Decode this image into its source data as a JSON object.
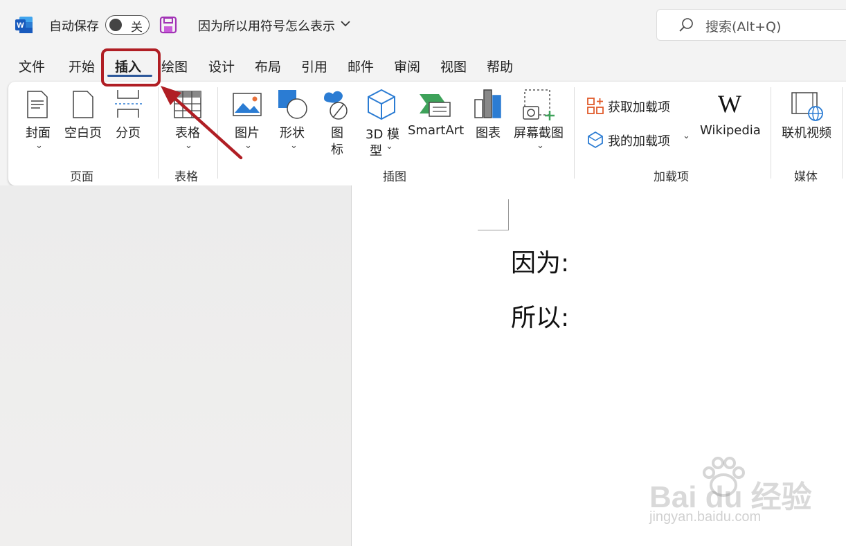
{
  "titlebar": {
    "app_icon": "word-icon",
    "autosave_label": "自动保存",
    "autosave_state": "关",
    "save_icon": "save-icon",
    "doc_title": "因为所以用符号怎么表示",
    "search_placeholder": "搜索(Alt+Q)"
  },
  "tabs": [
    "文件",
    "开始",
    "插入",
    "绘图",
    "设计",
    "布局",
    "引用",
    "邮件",
    "审阅",
    "视图",
    "帮助"
  ],
  "active_tab": "插入",
  "ribbon": {
    "pages": {
      "cover": "封面",
      "blank": "空白页",
      "break": "分页",
      "group": "页面"
    },
    "tables": {
      "table": "表格",
      "group": "表格"
    },
    "illustrations": {
      "picture": "图片",
      "shapes": "形状",
      "icons_1": "图",
      "icons_2": "标",
      "model_1": "3D 模",
      "model_2": "型",
      "smartart": "SmartArt",
      "chart": "图表",
      "screenshot": "屏幕截图",
      "group": "插图"
    },
    "addins": {
      "get": "获取加载项",
      "my": "我的加载项",
      "wikipedia": "Wikipedia",
      "group": "加载项"
    },
    "media": {
      "online_video": "联机视频",
      "group": "媒体"
    }
  },
  "document": {
    "line1": "因为:",
    "line2": "所以:"
  },
  "watermark": {
    "logo": "Bai du 经验",
    "url": "jingyan.baidu.com"
  },
  "colors": {
    "accent": "#2b579a",
    "highlight": "#b01e24",
    "arrow": "#b01e24"
  }
}
